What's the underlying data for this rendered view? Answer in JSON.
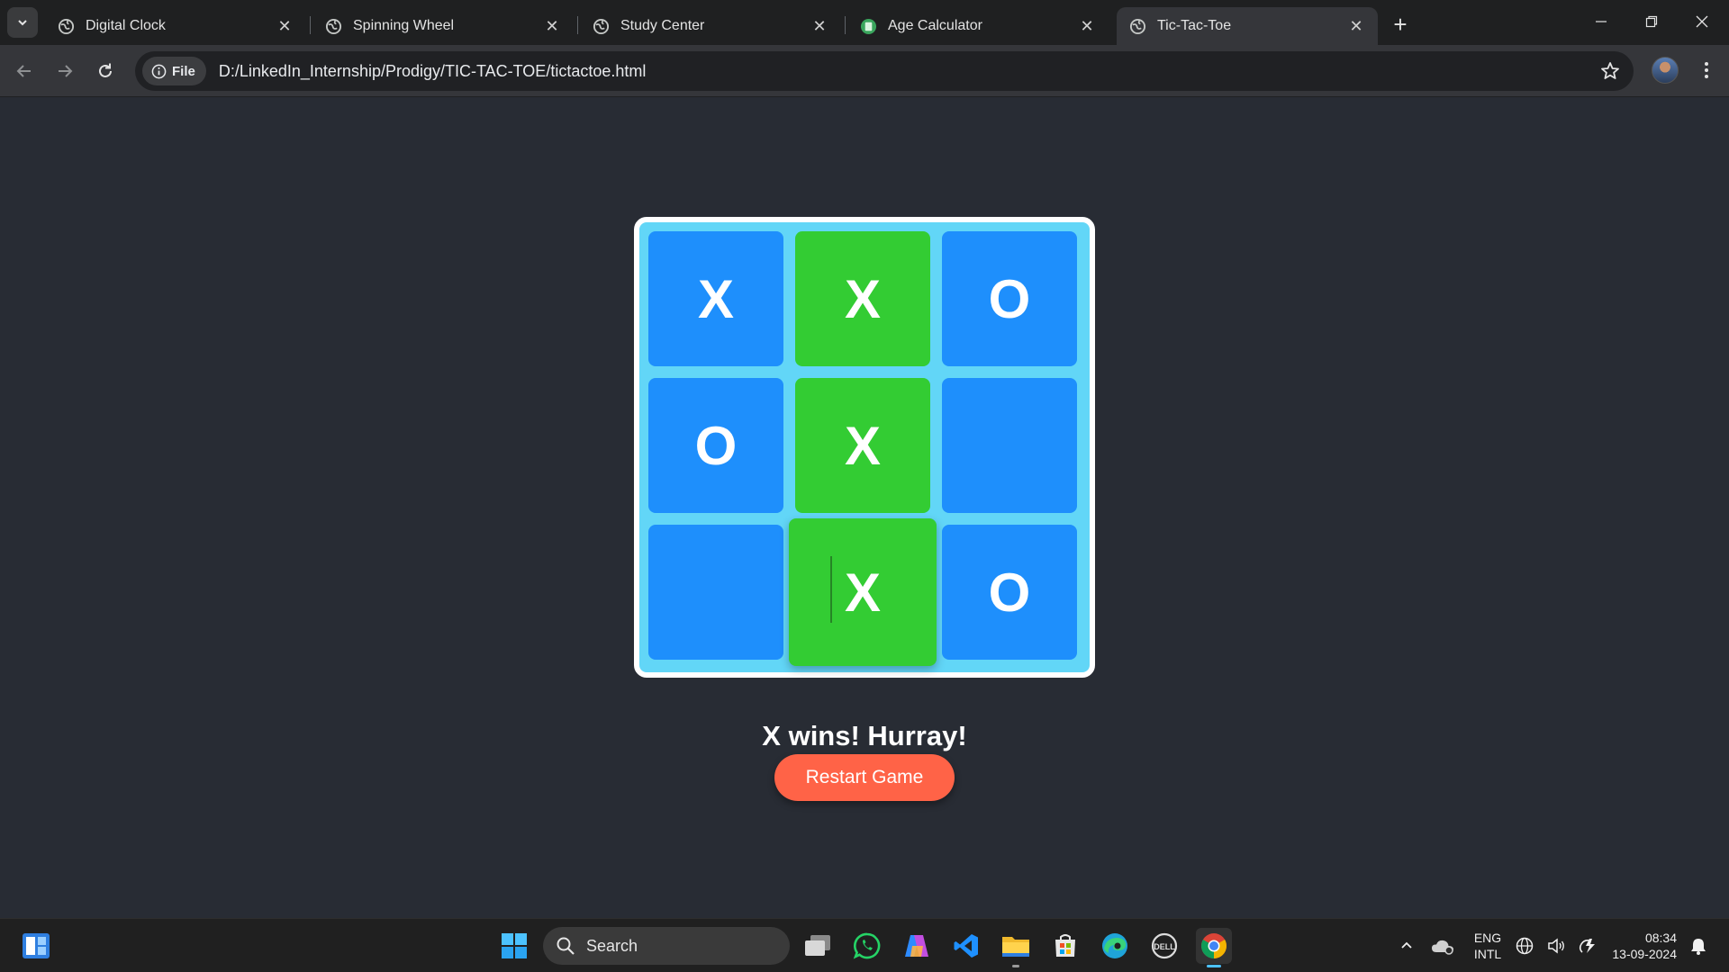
{
  "browser": {
    "tabs": [
      {
        "title": "Digital Clock"
      },
      {
        "title": "Spinning Wheel"
      },
      {
        "title": "Study Center"
      },
      {
        "title": "Age Calculator"
      },
      {
        "title": "Tic-Tac-Toe"
      }
    ],
    "chip_label": "File",
    "url": "D:/LinkedIn_Internship/Prodigy/TIC-TAC-TOE/tictactoe.html"
  },
  "game": {
    "cells": [
      "X",
      "X",
      "O",
      "O",
      "X",
      "",
      "",
      "X",
      "O"
    ],
    "winning_cells": [
      1,
      4,
      7
    ],
    "status": "X wins! Hurray!",
    "restart_label": "Restart Game"
  },
  "colors": {
    "cell": "#1e8ffc",
    "win_cell": "#33cc33",
    "board": "#62d6f7",
    "button": "#ff6347"
  },
  "taskbar": {
    "search_label": "Search",
    "lang_line1": "ENG",
    "lang_line2": "INTL",
    "time": "08:34",
    "date": "13-09-2024"
  }
}
